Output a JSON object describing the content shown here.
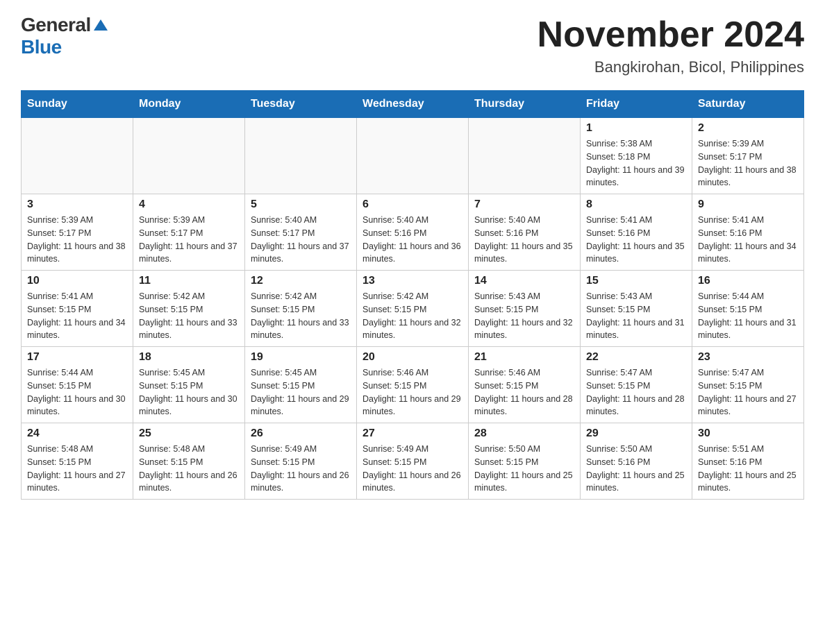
{
  "logo": {
    "general": "General",
    "triangle_label": "triangle-icon",
    "blue": "Blue"
  },
  "title": {
    "month_year": "November 2024",
    "location": "Bangkirohan, Bicol, Philippines"
  },
  "weekdays": [
    "Sunday",
    "Monday",
    "Tuesday",
    "Wednesday",
    "Thursday",
    "Friday",
    "Saturday"
  ],
  "weeks": [
    [
      {
        "day": "",
        "info": ""
      },
      {
        "day": "",
        "info": ""
      },
      {
        "day": "",
        "info": ""
      },
      {
        "day": "",
        "info": ""
      },
      {
        "day": "",
        "info": ""
      },
      {
        "day": "1",
        "info": "Sunrise: 5:38 AM\nSunset: 5:18 PM\nDaylight: 11 hours and 39 minutes."
      },
      {
        "day": "2",
        "info": "Sunrise: 5:39 AM\nSunset: 5:17 PM\nDaylight: 11 hours and 38 minutes."
      }
    ],
    [
      {
        "day": "3",
        "info": "Sunrise: 5:39 AM\nSunset: 5:17 PM\nDaylight: 11 hours and 38 minutes."
      },
      {
        "day": "4",
        "info": "Sunrise: 5:39 AM\nSunset: 5:17 PM\nDaylight: 11 hours and 37 minutes."
      },
      {
        "day": "5",
        "info": "Sunrise: 5:40 AM\nSunset: 5:17 PM\nDaylight: 11 hours and 37 minutes."
      },
      {
        "day": "6",
        "info": "Sunrise: 5:40 AM\nSunset: 5:16 PM\nDaylight: 11 hours and 36 minutes."
      },
      {
        "day": "7",
        "info": "Sunrise: 5:40 AM\nSunset: 5:16 PM\nDaylight: 11 hours and 35 minutes."
      },
      {
        "day": "8",
        "info": "Sunrise: 5:41 AM\nSunset: 5:16 PM\nDaylight: 11 hours and 35 minutes."
      },
      {
        "day": "9",
        "info": "Sunrise: 5:41 AM\nSunset: 5:16 PM\nDaylight: 11 hours and 34 minutes."
      }
    ],
    [
      {
        "day": "10",
        "info": "Sunrise: 5:41 AM\nSunset: 5:15 PM\nDaylight: 11 hours and 34 minutes."
      },
      {
        "day": "11",
        "info": "Sunrise: 5:42 AM\nSunset: 5:15 PM\nDaylight: 11 hours and 33 minutes."
      },
      {
        "day": "12",
        "info": "Sunrise: 5:42 AM\nSunset: 5:15 PM\nDaylight: 11 hours and 33 minutes."
      },
      {
        "day": "13",
        "info": "Sunrise: 5:42 AM\nSunset: 5:15 PM\nDaylight: 11 hours and 32 minutes."
      },
      {
        "day": "14",
        "info": "Sunrise: 5:43 AM\nSunset: 5:15 PM\nDaylight: 11 hours and 32 minutes."
      },
      {
        "day": "15",
        "info": "Sunrise: 5:43 AM\nSunset: 5:15 PM\nDaylight: 11 hours and 31 minutes."
      },
      {
        "day": "16",
        "info": "Sunrise: 5:44 AM\nSunset: 5:15 PM\nDaylight: 11 hours and 31 minutes."
      }
    ],
    [
      {
        "day": "17",
        "info": "Sunrise: 5:44 AM\nSunset: 5:15 PM\nDaylight: 11 hours and 30 minutes."
      },
      {
        "day": "18",
        "info": "Sunrise: 5:45 AM\nSunset: 5:15 PM\nDaylight: 11 hours and 30 minutes."
      },
      {
        "day": "19",
        "info": "Sunrise: 5:45 AM\nSunset: 5:15 PM\nDaylight: 11 hours and 29 minutes."
      },
      {
        "day": "20",
        "info": "Sunrise: 5:46 AM\nSunset: 5:15 PM\nDaylight: 11 hours and 29 minutes."
      },
      {
        "day": "21",
        "info": "Sunrise: 5:46 AM\nSunset: 5:15 PM\nDaylight: 11 hours and 28 minutes."
      },
      {
        "day": "22",
        "info": "Sunrise: 5:47 AM\nSunset: 5:15 PM\nDaylight: 11 hours and 28 minutes."
      },
      {
        "day": "23",
        "info": "Sunrise: 5:47 AM\nSunset: 5:15 PM\nDaylight: 11 hours and 27 minutes."
      }
    ],
    [
      {
        "day": "24",
        "info": "Sunrise: 5:48 AM\nSunset: 5:15 PM\nDaylight: 11 hours and 27 minutes."
      },
      {
        "day": "25",
        "info": "Sunrise: 5:48 AM\nSunset: 5:15 PM\nDaylight: 11 hours and 26 minutes."
      },
      {
        "day": "26",
        "info": "Sunrise: 5:49 AM\nSunset: 5:15 PM\nDaylight: 11 hours and 26 minutes."
      },
      {
        "day": "27",
        "info": "Sunrise: 5:49 AM\nSunset: 5:15 PM\nDaylight: 11 hours and 26 minutes."
      },
      {
        "day": "28",
        "info": "Sunrise: 5:50 AM\nSunset: 5:15 PM\nDaylight: 11 hours and 25 minutes."
      },
      {
        "day": "29",
        "info": "Sunrise: 5:50 AM\nSunset: 5:16 PM\nDaylight: 11 hours and 25 minutes."
      },
      {
        "day": "30",
        "info": "Sunrise: 5:51 AM\nSunset: 5:16 PM\nDaylight: 11 hours and 25 minutes."
      }
    ]
  ]
}
